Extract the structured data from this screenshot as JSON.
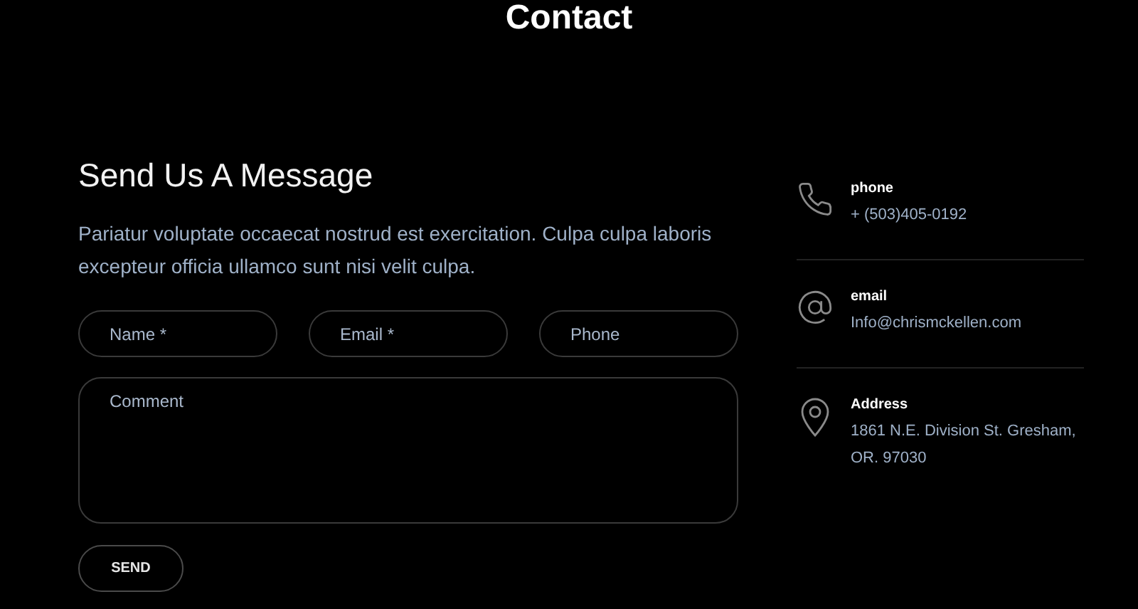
{
  "page_title": "Contact",
  "form": {
    "heading": "Send Us A Message",
    "intro": "Pariatur voluptate occaecat nostrud est exercitation. Culpa culpa laboris excepteur officia ullamco sunt nisi velit culpa.",
    "fields": [
      {
        "placeholder": "Name *"
      },
      {
        "placeholder": "Email *"
      },
      {
        "placeholder": "Phone"
      }
    ],
    "comment": {
      "placeholder": "Comment"
    },
    "submit": "SEND"
  },
  "contacts": [
    {
      "kind": "phone",
      "label": "phone",
      "value": "+ (503)405-0192"
    },
    {
      "kind": "email",
      "label": "email",
      "value": "Info@chrismckellen.com"
    },
    {
      "kind": "address",
      "label": "Address",
      "value": "1861 N.E. Division St. Gresham, OR. 97030"
    }
  ]
}
